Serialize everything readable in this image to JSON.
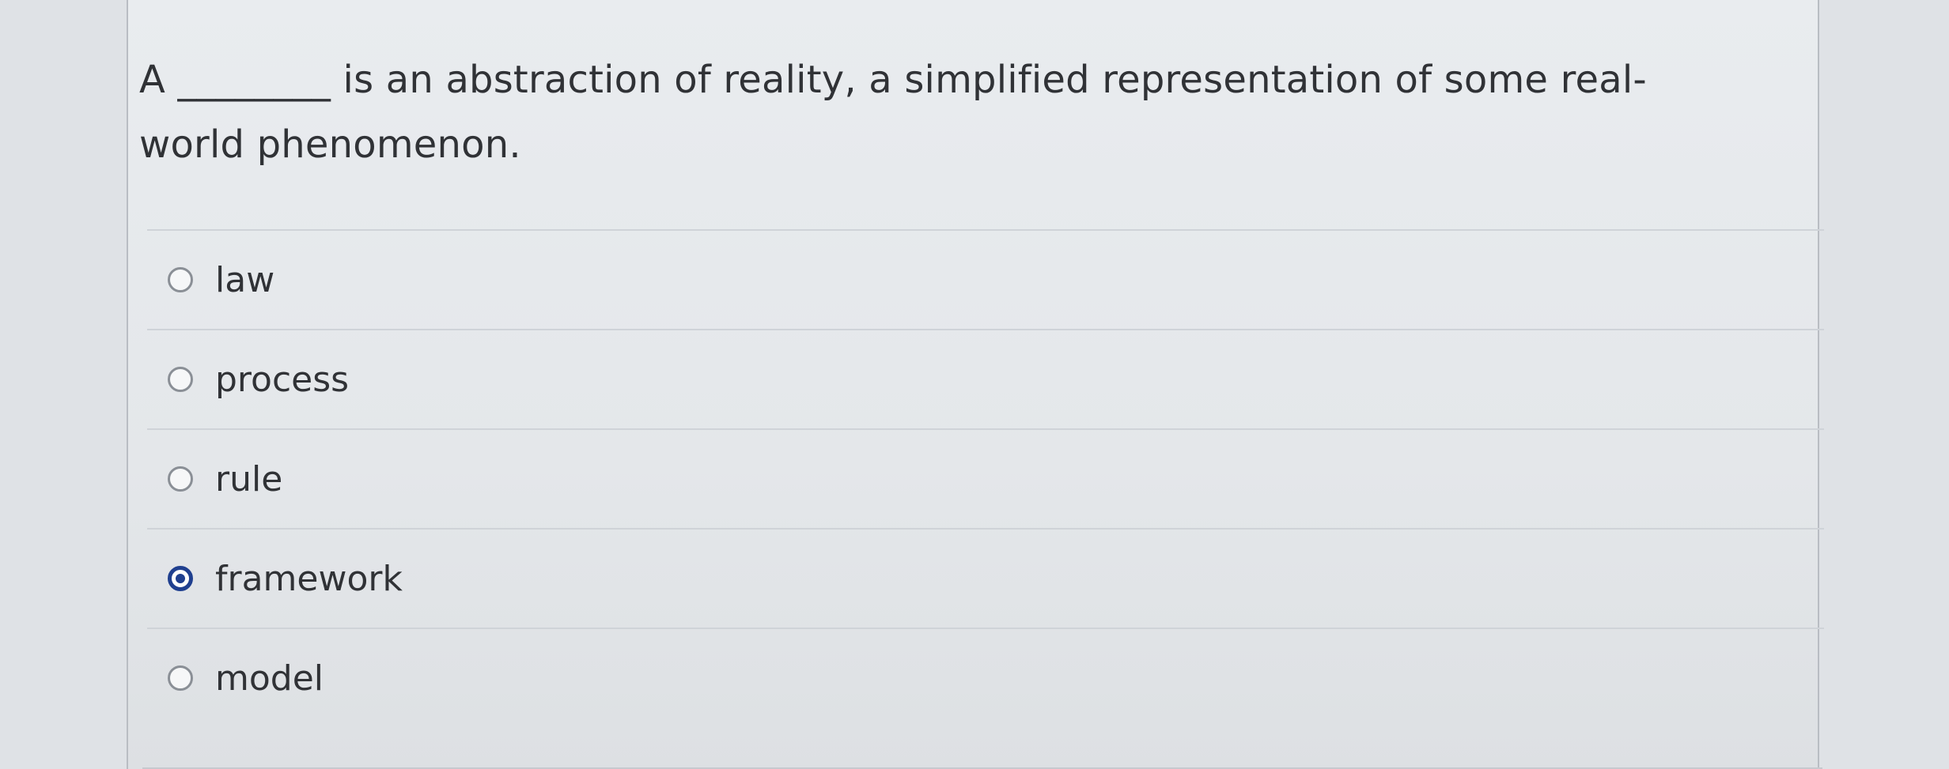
{
  "question": {
    "text": "A ________ is an abstraction of reality, a simplified representation of some real-world phenomenon."
  },
  "answers": [
    {
      "label": "law",
      "selected": false
    },
    {
      "label": "process",
      "selected": false
    },
    {
      "label": "rule",
      "selected": false
    },
    {
      "label": "framework",
      "selected": true
    },
    {
      "label": "model",
      "selected": false
    }
  ],
  "colors": {
    "selected_radio": "#1f3f8f",
    "text": "#303236"
  }
}
